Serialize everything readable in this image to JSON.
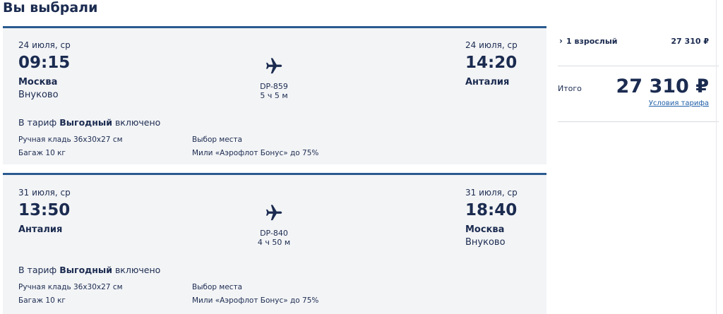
{
  "page": {
    "title": "Вы выбрали"
  },
  "flights": [
    {
      "dep_date": "24 июля, ср",
      "dep_time": "09:15",
      "dep_city": "Москва",
      "dep_airport": "Внуково",
      "arr_date": "24 июля, ср",
      "arr_time": "14:20",
      "arr_city": "Анталия",
      "arr_airport": "",
      "flight_no": "DP-859",
      "duration": "5 ч 5 м",
      "tariff_prefix": "В тариф ",
      "tariff_name": "Выгодный",
      "tariff_suffix": " включено",
      "features": {
        "hand_luggage": "Ручная кладь 36x30x27 см",
        "baggage": "Багаж 10 кг",
        "seat": "Выбор места",
        "miles": "Мили «Аэрофлот Бонус» до 75%"
      }
    },
    {
      "dep_date": "31 июля, ср",
      "dep_time": "13:50",
      "dep_city": "Анталия",
      "dep_airport": "",
      "arr_date": "31 июля, ср",
      "arr_time": "18:40",
      "arr_city": "Москва",
      "arr_airport": "Внуково",
      "flight_no": "DP-840",
      "duration": "4 ч 50 м",
      "tariff_prefix": "В тариф ",
      "tariff_name": "Выгодный",
      "tariff_suffix": " включено",
      "features": {
        "hand_luggage": "Ручная кладь 36x30x27 см",
        "baggage": "Багаж 10 кг",
        "seat": "Выбор места",
        "miles": "Мили «Аэрофлот Бонус» до 75%"
      }
    }
  ],
  "summary": {
    "chevron": "›",
    "passengers": "1 взрослый",
    "passengers_price": "27 310 ₽",
    "total_label": "Итого",
    "total_price": "27 310 ₽",
    "tariff_link": "Условия тарифа"
  },
  "colors": {
    "accent": "#2a5a8f",
    "text": "#1b2b50",
    "link": "#1f5fa8",
    "card_bg": "#f3f4f6"
  }
}
